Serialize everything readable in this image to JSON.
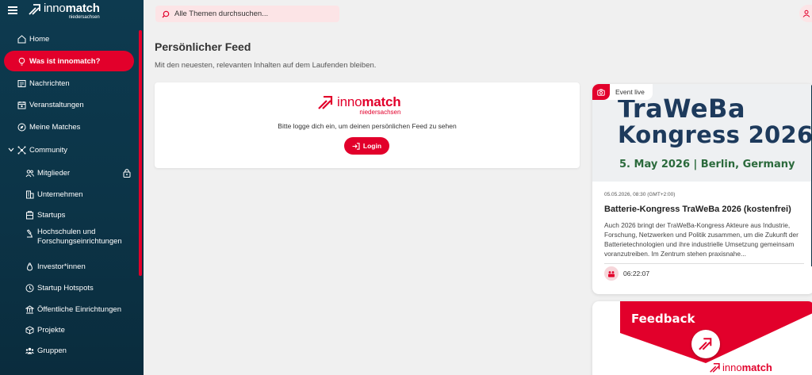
{
  "brand": {
    "main_light": "inno",
    "main_bold": "match",
    "sub": "niedersachsen"
  },
  "colors": {
    "accent": "#e2002b",
    "sidebar": "#0c3447",
    "accent_soft": "#fce4e6"
  },
  "sidebar": {
    "items": [
      {
        "label": "Home",
        "icon": "home-icon"
      },
      {
        "label": "Was ist innomatch?",
        "icon": "lightbulb-icon",
        "active": true
      },
      {
        "label": "Nachrichten",
        "icon": "newspaper-icon"
      },
      {
        "label": "Veranstaltungen",
        "icon": "calendar-icon"
      },
      {
        "label": "Meine Matches",
        "icon": "compass-icon"
      },
      {
        "label": "Community",
        "icon": "network-icon",
        "expanded": true
      },
      {
        "label": "Mitglieder",
        "icon": "users-icon",
        "locked": true
      },
      {
        "label": "Unternehmen",
        "icon": "building-icon"
      },
      {
        "label": "Startups",
        "icon": "startup-icon"
      },
      {
        "label": "Hochschulen und",
        "label2": "Forschungseinrichtungen",
        "icon": "microscope-icon"
      },
      {
        "label": "Investor*innen",
        "icon": "moneybag-icon"
      },
      {
        "label": "Startup Hotspots",
        "icon": "clock-icon"
      },
      {
        "label": "Öffentliche Einrichtungen",
        "icon": "institution-icon"
      },
      {
        "label": "Projekte",
        "icon": "cube-icon"
      },
      {
        "label": "Gruppen",
        "icon": "group-icon"
      }
    ]
  },
  "search": {
    "placeholder": "Alle Themen durchsuchen..."
  },
  "main": {
    "title": "Persönlicher Feed",
    "subtitle": "Mit den neuesten, relevanten Inhalten auf dem Laufenden bleiben.",
    "login_prompt": "Bitte logge dich ein, um deinen persönlichen Feed zu sehen",
    "login_label": "Login"
  },
  "event": {
    "tag": "Event live",
    "banner_line1": "TraWeBa",
    "banner_line2": "Kongress 2026",
    "banner_line3": "5. May 2026 | Berlin, Germany",
    "date": "05.05.2026, 08:30 (GMT+2:00)",
    "title": "Batterie-Kongress TraWeBa 2026 (kostenfrei)",
    "description": "Auch 2026 bringt der TraWeBa-Kongress Akteure aus Industrie, Forschung, Netzwerken und Politik zusammen, um die Zukunft der Batterietechnologien und ihre industrielle Umsetzung gemeinsam voranzutreiben. Im Zentrum stehen praxisnahe...",
    "countdown": "06:22:07"
  },
  "feedback": {
    "title": "Feedback"
  }
}
